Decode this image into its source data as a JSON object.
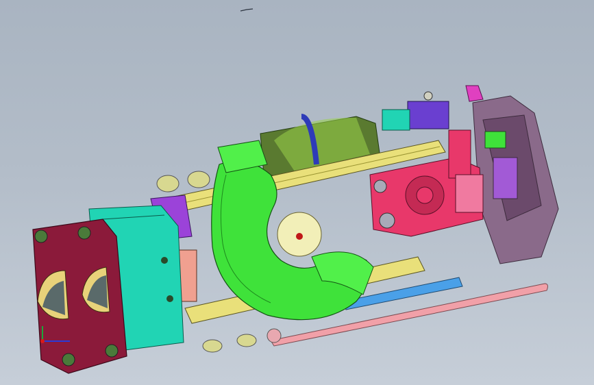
{
  "viewport": {
    "background_top": "#a9b4c1",
    "background_bottom": "#c6ced8"
  },
  "model": {
    "part_colors": {
      "housing_maroon": "#8b1a3a",
      "block_teal": "#21d4b4",
      "elbow_green": "#3fe23a",
      "plate_pink": "#e8386a",
      "bracket_purple": "#9b43d9",
      "rail_yellow": "#e9e07a",
      "rod_pink": "#f1a0a8",
      "motor_olive": "#4c6b2b",
      "rear_block_mauve": "#8a6a8a"
    }
  },
  "triad": {
    "x_axis_color": "#2a3bd8",
    "y_axis_color": "#1aa83a",
    "z_axis_color": "#d81a1a"
  }
}
